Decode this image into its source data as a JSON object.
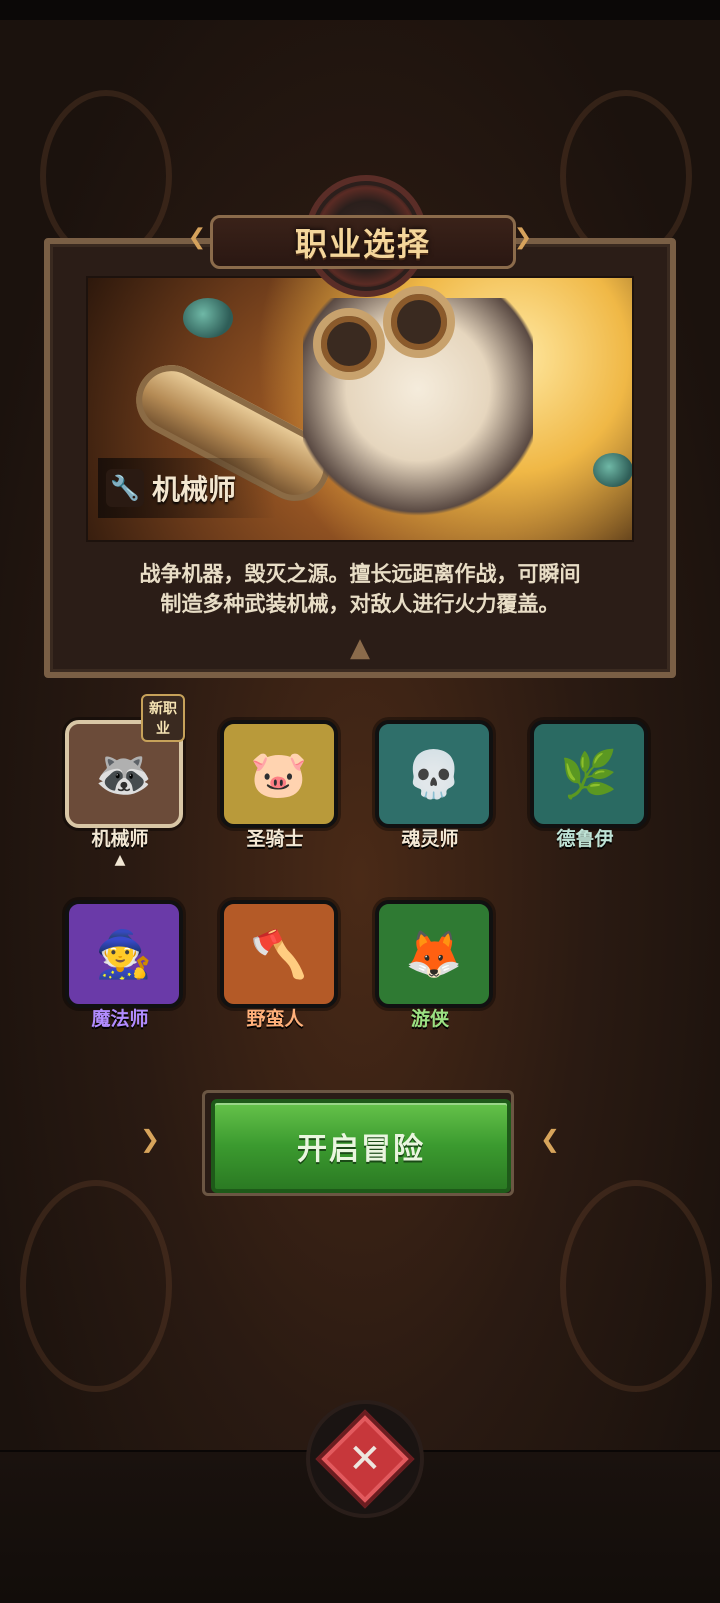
{
  "header": {
    "title": "职业选择"
  },
  "selected_class": {
    "name": "机械师",
    "description_line1": "战争机器，毁灭之源。擅长远距离作战，可瞬间",
    "description_line2": "制造多种武装机械，对敌人进行火力覆盖。"
  },
  "classes": [
    {
      "name": "机械师",
      "color": "#f2e7d4",
      "frame": "#6b4b39",
      "selected": true,
      "badge": "新职业"
    },
    {
      "name": "圣骑士",
      "color": "#f2e7d4",
      "frame": "#b99a3a"
    },
    {
      "name": "魂灵师",
      "color": "#f2e7d4",
      "frame": "#2f6f6a"
    },
    {
      "name": "德鲁伊",
      "color": "#bfe3d6",
      "frame": "#2a6a62"
    },
    {
      "name": "魔法师",
      "color": "#b18cff",
      "frame": "#6a3aa8"
    },
    {
      "name": "野蛮人",
      "color": "#ffb07a",
      "frame": "#b45a27"
    },
    {
      "name": "游侠",
      "color": "#9be082",
      "frame": "#2f7a33"
    }
  ],
  "actions": {
    "start_label": "开启冒险"
  },
  "icons": {
    "hero_class_icon": "wrench-icon",
    "title_wings": "ornament-arrow-icon",
    "bottom": "crossed-swords-icon"
  }
}
